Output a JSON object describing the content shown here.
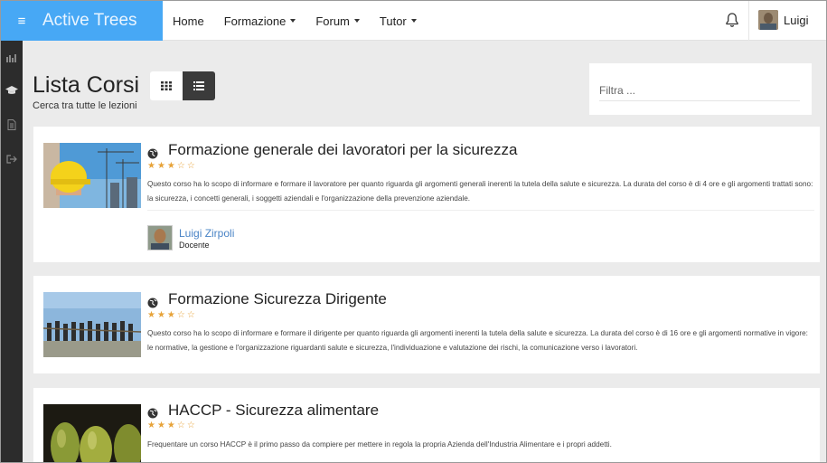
{
  "app": {
    "brand": "Active Trees",
    "menu_icon": "hamburger-icon"
  },
  "nav": {
    "items": [
      {
        "label": "Home",
        "dropdown": false
      },
      {
        "label": "Formazione",
        "dropdown": true
      },
      {
        "label": "Forum",
        "dropdown": true
      },
      {
        "label": "Tutor",
        "dropdown": true
      }
    ],
    "user_name": "Luigi"
  },
  "rail": {
    "icons": [
      "chart-icon",
      "graduation-cap-icon",
      "document-icon",
      "sign-out-icon"
    ]
  },
  "header": {
    "title": "Lista Corsi",
    "subtitle": "Cerca tra tutte le lezioni",
    "view_modes": [
      "grid",
      "list"
    ],
    "active_view": "list"
  },
  "filter": {
    "placeholder": "Filtra ..."
  },
  "courses": [
    {
      "title": "Formazione generale dei lavoratori per la sicurezza",
      "rating": 3,
      "max_rating": 5,
      "description": "Questo corso ha lo scopo di informare e formare il lavoratore per quanto riguarda gli argomenti generali inerenti la tutela della salute e sicurezza. La durata del corso è di 4 ore e gli argomenti trattati sono: la sicurezza, i concetti generali, i soggetti aziendali e l'organizzazione della prevenzione aziendale.",
      "author_name": "Luigi Zirpoli",
      "author_role": "Docente"
    },
    {
      "title": "Formazione Sicurezza Dirigente",
      "rating": 3,
      "max_rating": 5,
      "description": "Questo corso ha lo scopo di informare e formare il dirigente per quanto riguarda gli argomenti inerenti la tutela della salute e sicurezza. La durata del corso è di 16 ore e gli argomenti normative in vigore: le normative, la gestione e l'organizzazione riguardanti salute e sicurezza, l'individuazione e valutazione dei rischi, la comunicazione verso i lavoratori."
    },
    {
      "title": "HACCP - Sicurezza alimentare",
      "rating": 3,
      "max_rating": 5,
      "description": "Frequentare un corso HACCP è il primo passo da compiere per mettere in regola la propria Azienda dell'Industria Alimentare e i propri addetti."
    }
  ],
  "colors": {
    "brand_bg": "#47a8f5",
    "star": "#e7a33a",
    "author_link": "#4a84c6",
    "rail_bg": "#2c2c2c"
  }
}
